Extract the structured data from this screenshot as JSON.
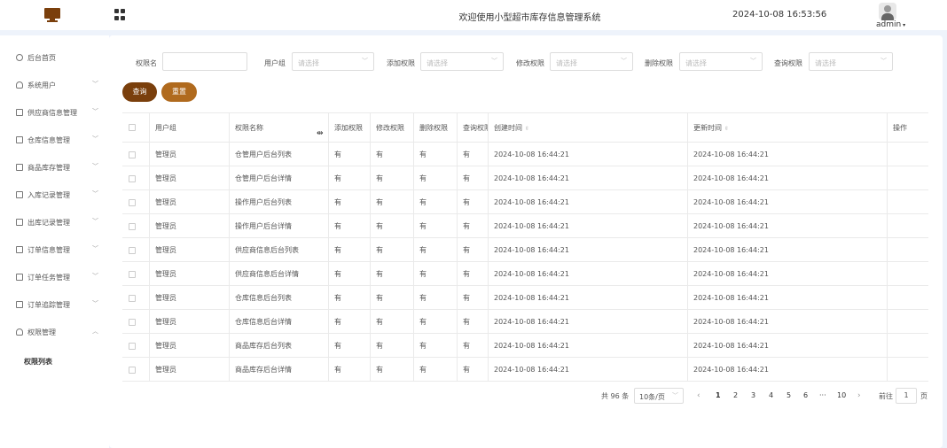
{
  "header": {
    "title": "欢迎使用小型超市库存信息管理系统",
    "datetime": "2024-10-08 16:53:56",
    "username": "admin"
  },
  "sidebar": {
    "items": [
      {
        "label": "后台首页",
        "icon": "clock-icon"
      },
      {
        "label": "系统用户",
        "icon": "user-icon"
      },
      {
        "label": "供应商信息管理",
        "icon": "list-icon"
      },
      {
        "label": "仓库信息管理",
        "icon": "list-icon"
      },
      {
        "label": "商品库存管理",
        "icon": "list-icon"
      },
      {
        "label": "入库记录管理",
        "icon": "list-icon"
      },
      {
        "label": "出库记录管理",
        "icon": "list-icon"
      },
      {
        "label": "订单信息管理",
        "icon": "list-icon"
      },
      {
        "label": "订单任务管理",
        "icon": "list-icon"
      },
      {
        "label": "订单追踪管理",
        "icon": "list-icon"
      },
      {
        "label": "权限管理",
        "icon": "user-icon"
      }
    ],
    "sub_item": "权限列表"
  },
  "filters": {
    "permission_name_label": "权限名",
    "user_group_label": "用户组",
    "add_perm_label": "添加权限",
    "edit_perm_label": "修改权限",
    "delete_perm_label": "删除权限",
    "query_perm_label": "查询权限",
    "select_placeholder": "请选择",
    "query_button": "查询",
    "reset_button": "重置"
  },
  "table": {
    "headers": [
      "用户组",
      "权限名称",
      "添加权限",
      "修改权限",
      "删除权限",
      "查询权限",
      "创建时间",
      "更新时间",
      "操作"
    ],
    "rows": [
      [
        "管理员",
        "仓管用户后台列表",
        "有",
        "有",
        "有",
        "有",
        "2024-10-08 16:44:21",
        "2024-10-08 16:44:21"
      ],
      [
        "管理员",
        "仓管用户后台详情",
        "有",
        "有",
        "有",
        "有",
        "2024-10-08 16:44:21",
        "2024-10-08 16:44:21"
      ],
      [
        "管理员",
        "操作用户后台列表",
        "有",
        "有",
        "有",
        "有",
        "2024-10-08 16:44:21",
        "2024-10-08 16:44:21"
      ],
      [
        "管理员",
        "操作用户后台详情",
        "有",
        "有",
        "有",
        "有",
        "2024-10-08 16:44:21",
        "2024-10-08 16:44:21"
      ],
      [
        "管理员",
        "供应商信息后台列表",
        "有",
        "有",
        "有",
        "有",
        "2024-10-08 16:44:21",
        "2024-10-08 16:44:21"
      ],
      [
        "管理员",
        "供应商信息后台详情",
        "有",
        "有",
        "有",
        "有",
        "2024-10-08 16:44:21",
        "2024-10-08 16:44:21"
      ],
      [
        "管理员",
        "仓库信息后台列表",
        "有",
        "有",
        "有",
        "有",
        "2024-10-08 16:44:21",
        "2024-10-08 16:44:21"
      ],
      [
        "管理员",
        "仓库信息后台详情",
        "有",
        "有",
        "有",
        "有",
        "2024-10-08 16:44:21",
        "2024-10-08 16:44:21"
      ],
      [
        "管理员",
        "商品库存后台列表",
        "有",
        "有",
        "有",
        "有",
        "2024-10-08 16:44:21",
        "2024-10-08 16:44:21"
      ],
      [
        "管理员",
        "商品库存后台详情",
        "有",
        "有",
        "有",
        "有",
        "2024-10-08 16:44:21",
        "2024-10-08 16:44:21"
      ]
    ]
  },
  "pagination": {
    "total": "共 96 条",
    "page_size": "10条/页",
    "pages": [
      "1",
      "2",
      "3",
      "4",
      "5",
      "6",
      "···",
      "10"
    ],
    "goto_label": "前往",
    "current": "1",
    "page_suffix": "页"
  },
  "colors": {
    "primary": "#7a3f0c",
    "secondary": "#b06a1e",
    "background": "#eef3fb"
  }
}
